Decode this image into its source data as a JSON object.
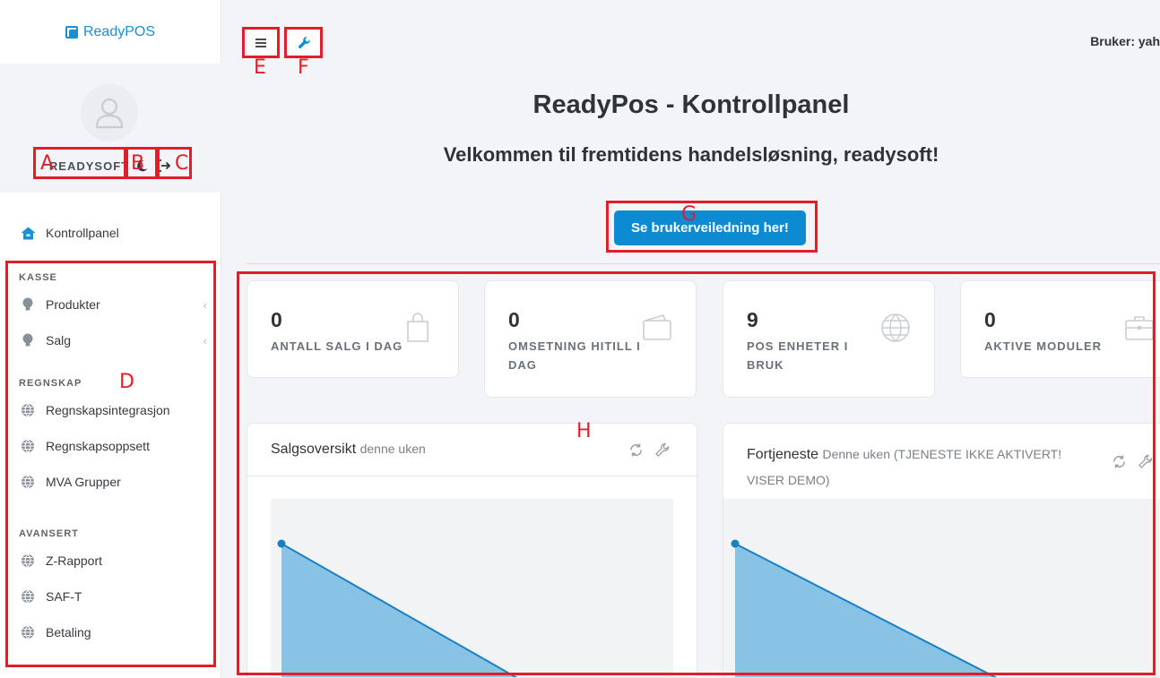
{
  "brand": {
    "name": "ReadyPOS"
  },
  "profile": {
    "username": "READYSOFT"
  },
  "sidebar": {
    "dashboard": "Kontrollpanel",
    "sections": [
      {
        "heading": "KASSE",
        "items": [
          {
            "label": "Produkter",
            "icon": "lightbulb-icon",
            "has_submenu": true
          },
          {
            "label": "Salg",
            "icon": "lightbulb-icon",
            "has_submenu": true
          }
        ]
      },
      {
        "heading": "REGNSKAP",
        "items": [
          {
            "label": "Regnskapsintegrasjon",
            "icon": "globe-icon"
          },
          {
            "label": "Regnskapsoppsett",
            "icon": "globe-icon"
          },
          {
            "label": "MVA Grupper",
            "icon": "globe-icon"
          }
        ]
      },
      {
        "heading": "AVANSERT",
        "items": [
          {
            "label": "Z-Rapport",
            "icon": "globe-icon"
          },
          {
            "label": "SAF-T",
            "icon": "globe-icon"
          },
          {
            "label": "Betaling",
            "icon": "globe-icon"
          }
        ]
      }
    ]
  },
  "header": {
    "user_label": "Bruker: yah"
  },
  "main": {
    "title": "ReadyPos - Kontrollpanel",
    "welcome": "Velkommen til fremtidens handelsløsning, readysoft!",
    "guide_button": "Se brukerveiledning her!",
    "stats": [
      {
        "value": "0",
        "label": "ANTALL SALG I DAG",
        "icon": "shopping-bag-icon"
      },
      {
        "value": "0",
        "label": "OMSETNING HITILL I DAG",
        "icon": "wallet-icon"
      },
      {
        "value": "9",
        "label": "POS ENHETER I BRUK",
        "icon": "globe-icon"
      },
      {
        "value": "0",
        "label": "AKTIVE MODULER",
        "icon": "briefcase-icon"
      }
    ],
    "panels": [
      {
        "title": "Salgsoversikt",
        "subtitle": "denne uken"
      },
      {
        "title": "Fortjeneste",
        "subtitle": "Denne uken (TJENESTE IKKE AKTIVERT!",
        "subtitle2": "VISER DEMO)"
      }
    ]
  },
  "annotations": {
    "A": "A",
    "B": "B",
    "C": "C",
    "D": "D",
    "E": "E",
    "F": "F",
    "G": "G",
    "H": "H"
  },
  "colors": {
    "accent": "#0d8bd2",
    "annotation": "#e11d2a",
    "chart_fill": "#88c3e5",
    "chart_line": "#1a80c4"
  },
  "chart_data": [
    {
      "type": "area",
      "title": "Salgsoversikt",
      "series": [
        {
          "values": [
            1,
            0
          ]
        }
      ]
    },
    {
      "type": "area",
      "title": "Fortjeneste",
      "series": [
        {
          "values": [
            1,
            0
          ]
        }
      ]
    }
  ]
}
